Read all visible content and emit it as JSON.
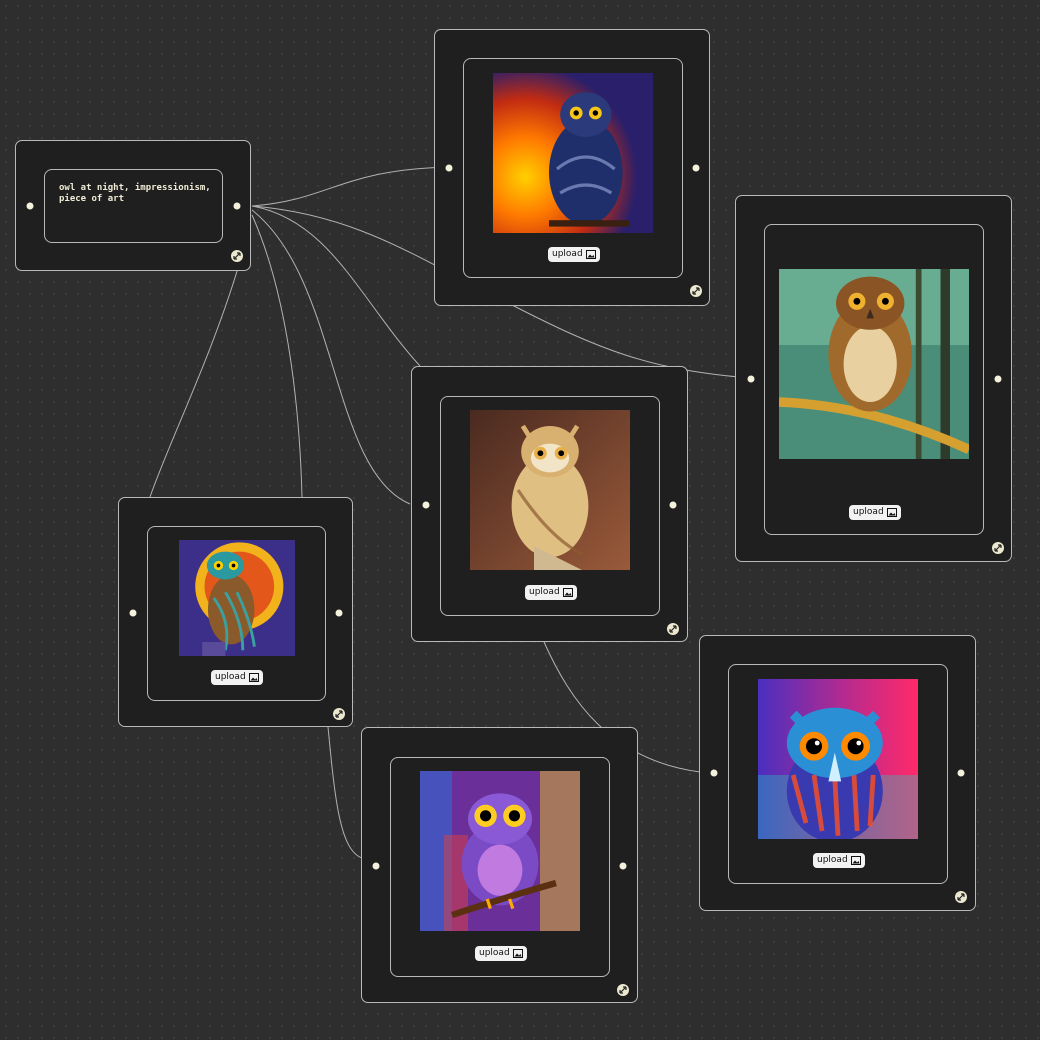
{
  "prompt_node": {
    "text": "owl at night, impressionism,\npiece of art"
  },
  "image_nodes": [
    {
      "id": "owl-1",
      "upload_label": "upload",
      "icon": "image-icon",
      "palette": {
        "bg": "#c12b12",
        "glow": "#ffb400",
        "body": "#1f2f6b",
        "eye": "#f5c518"
      }
    },
    {
      "id": "owl-2",
      "upload_label": "upload",
      "icon": "image-icon",
      "palette": {
        "bg": "#4a8e7a",
        "glow": "#8fc6a8",
        "body": "#a06a2c",
        "eye": "#f0b030"
      }
    },
    {
      "id": "owl-3",
      "upload_label": "upload",
      "icon": "image-icon",
      "palette": {
        "bg": "#6b3a28",
        "glow": "#9a5a3a",
        "body": "#e0bf82",
        "eye": "#e8b04a"
      }
    },
    {
      "id": "owl-4",
      "upload_label": "upload",
      "icon": "image-icon",
      "palette": {
        "bg": "#3b2f8a",
        "glow": "#f2b21b",
        "body": "#8a5a2a",
        "eye": "#ffd000"
      }
    },
    {
      "id": "owl-5",
      "upload_label": "upload",
      "icon": "image-icon",
      "palette": {
        "bg": "#6b2f9a",
        "glow": "#e0c020",
        "body": "#7b4bc6",
        "eye": "#ffcc22"
      }
    },
    {
      "id": "owl-6",
      "upload_label": "upload",
      "icon": "image-icon",
      "palette": {
        "bg": "#4a2fc0",
        "glow": "#ff2a6a",
        "body": "#2b8fd6",
        "eye": "#ff8a00"
      }
    }
  ],
  "colors": {
    "canvas": "#2e2e2e",
    "node": "#1f1f1f",
    "border": "#b9b9b9",
    "edge": "#c9c9c9",
    "port": "#f4f1dc"
  }
}
